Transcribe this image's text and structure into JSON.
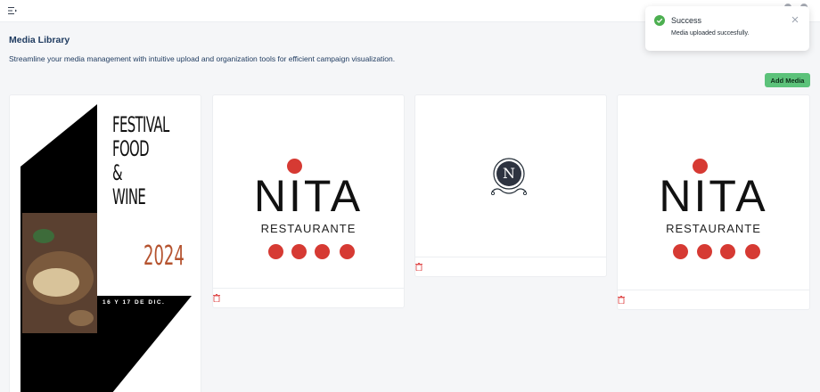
{
  "page": {
    "title": "Media Library",
    "subtitle": "Streamline your media management with intuitive upload and organization tools for efficient campaign visualization."
  },
  "toolbar": {
    "add_media_label": "Add Media"
  },
  "toast": {
    "title": "Success",
    "message": "Media uploaded succesfully."
  },
  "cards": [
    {
      "type": "poster",
      "title_lines": [
        "FESTIVAL",
        "FOOD &",
        "WINE"
      ],
      "year": "2024",
      "date": "16 Y 17 DE DIC."
    },
    {
      "type": "logo",
      "word": "NITA",
      "sub": "RESTAURANTE"
    },
    {
      "type": "emblem",
      "letter": "N"
    },
    {
      "type": "logo",
      "word": "NITA",
      "sub": "RESTAURANTE"
    }
  ],
  "colors": {
    "accent_green": "#5cc27a",
    "brand_red": "#d63a33",
    "title_blue": "#1e3a5f",
    "poster_orange": "#b5532f",
    "delete_red": "#e05252"
  },
  "icons": {
    "menu": "menu-icon",
    "delete": "trash-icon",
    "success": "check-circle-icon",
    "close": "close-icon"
  }
}
